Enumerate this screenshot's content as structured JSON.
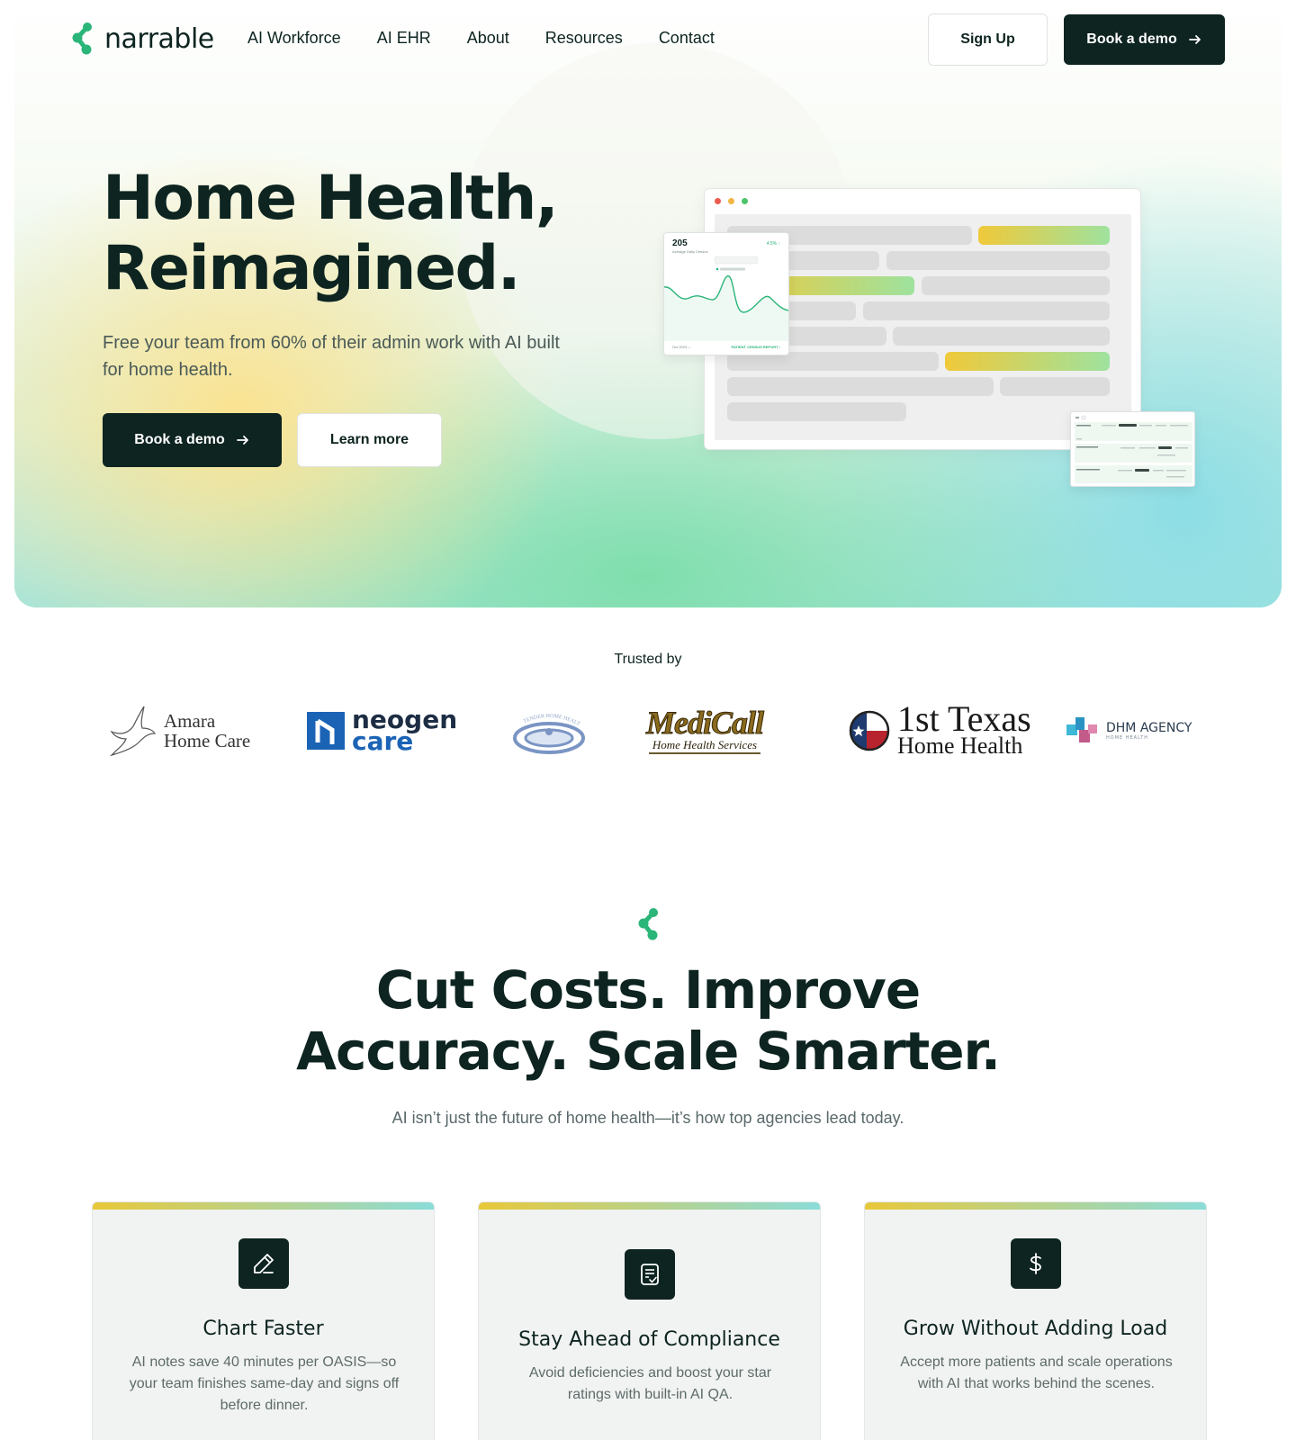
{
  "brand": {
    "name": "narrable",
    "accent": "#2bb579",
    "dark": "#0d2420"
  },
  "nav": {
    "links": [
      "AI Workforce",
      "AI EHR",
      "About",
      "Resources",
      "Contact"
    ],
    "signup_label": "Sign Up",
    "demo_label": "Book a demo"
  },
  "hero": {
    "title_line1": "Home Health,",
    "title_line2": "Reimagined.",
    "subtitle": "Free your team from 60% of their admin work with AI built for home health.",
    "cta_primary": "Book a demo",
    "cta_secondary": "Learn more",
    "mockup": {
      "stat_value": "205",
      "stat_caption": "Average Daily Census",
      "stat_change": "4.5% ↑",
      "footer_left": "Oct 2023 ⌄",
      "footer_right": "PATIENT CENSUS REPORT ›"
    }
  },
  "trusted": {
    "heading": "Trusted by",
    "logos": [
      {
        "line1": "Amara",
        "line2": "Home Care"
      },
      {
        "line1": "neogen",
        "line2": "care"
      },
      {
        "line1": "TENDER HOME HEALTH"
      },
      {
        "line1": "MediCall",
        "line2": "Home Health Services"
      },
      {
        "line1": "1st Texas",
        "line2": "Home Health"
      },
      {
        "line1": "DHM AGENCY",
        "line2": "HOME HEALTH"
      }
    ]
  },
  "section": {
    "title_line1": "Cut Costs. Improve",
    "title_line2": "Accuracy. Scale Smarter.",
    "subtitle": "AI isn’t just the future of home health—it’s how top agencies lead today."
  },
  "cards": [
    {
      "icon": "pencil-icon",
      "title": "Chart Faster",
      "text": "AI notes save 40 minutes per OASIS—so your team finishes same-day and signs off before dinner."
    },
    {
      "icon": "document-check-icon",
      "title": "Stay Ahead of Compliance",
      "text": "Avoid deficiencies and boost your star ratings with built-in AI QA."
    },
    {
      "icon": "dollar-icon",
      "title": "Grow Without Adding Load",
      "text": "Accept more patients and scale operations with AI that works behind the scenes."
    }
  ]
}
